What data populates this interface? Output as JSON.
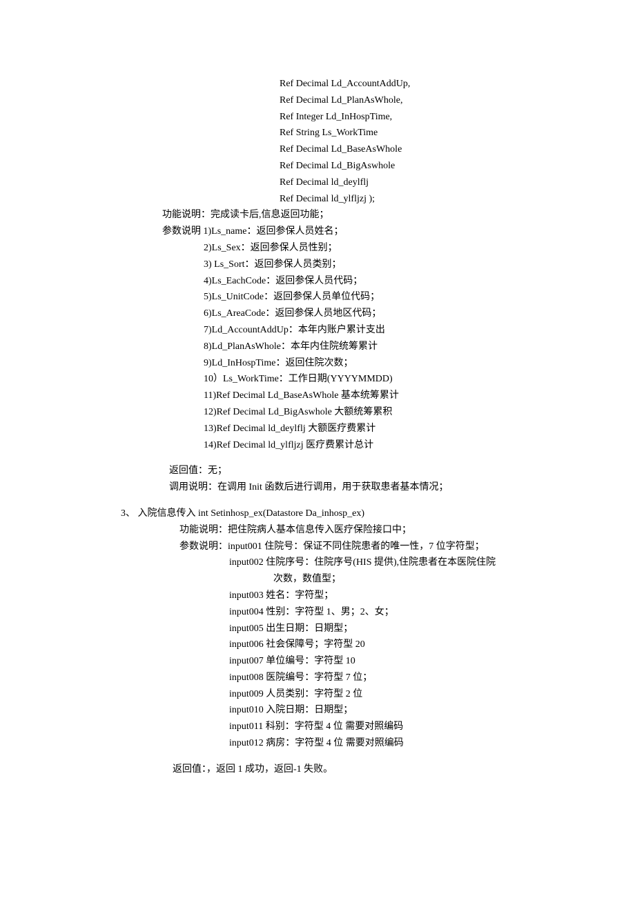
{
  "refParams": [
    "Ref Decimal Ld_AccountAddUp,",
    "Ref Decimal Ld_PlanAsWhole,",
    "Ref Integer Ld_InHospTime,",
    "Ref String Ls_WorkTime",
    "Ref Decimal Ld_BaseAsWhole",
    "Ref Decimal Ld_BigAswhole",
    "Ref Decimal ld_deylflj",
    "Ref Decimal ld_ylfljzj );"
  ],
  "funcDesc": "功能说明：完成读卡后,信息返回功能；",
  "paramHead": "参数说明 1)Ls_name：返回参保人员姓名；",
  "params": [
    "2)Ls_Sex：返回参保人员性别；",
    "3) Ls_Sort：返回参保人员类别；",
    "4)Ls_EachCode：返回参保人员代码；",
    "5)Ls_UnitCode：返回参保人员单位代码；",
    "6)Ls_AreaCode：返回参保人员地区代码；",
    "7)Ld_AccountAddUp：本年内账户累计支出",
    "8)Ld_PlanAsWhole：本年内住院统筹累计",
    "9)Ld_InHospTime：返回住院次数；",
    "10）Ls_WorkTime：工作日期(YYYYMMDD)",
    "11)Ref Decimal Ld_BaseAsWhole  基本统筹累计",
    "12)Ref Decimal Ld_BigAswhole    大额统筹累积",
    "13)Ref Decimal ld_deylflj  大额医疗费累计",
    "14)Ref Decimal ld_ylfljzj    医疗费累计总计"
  ],
  "returnVal": "返回值：无；",
  "callDesc": "调用说明：在调用 Init 函数后进行调用，用于获取患者基本情况；",
  "section3": {
    "head": "3、        入院信息传入  int Setinhosp_ex(Datastore Da_inhosp_ex)",
    "funcDesc": "功能说明：把住院病人基本信息传入医疗保险接口中；",
    "paramHead": "参数说明：input001  住院号：保证不同住院患者的唯一性，7 位字符型；",
    "paramL2a": "input002  住院序号：住院序号(HIS 提供),住院患者在本医院住院",
    "paramL2b": "次数，数值型；",
    "params": [
      "input003  姓名：字符型；",
      "input004  性别：字符型  1、男；2、女；",
      "input005  出生日期：日期型；",
      "input006  社会保障号；字符型 20",
      "input007  单位编号：字符型 10",
      "input008  医院编号：字符型 7 位；",
      "input009  人员类别：字符型 2 位",
      "input010  入院日期：日期型；",
      "input011  科别：字符型 4 位  需要对照编码",
      "input012  病房：字符型 4 位  需要对照编码"
    ],
    "returnVal": "返回值：，返回 1 成功，返回-1 失败。"
  }
}
